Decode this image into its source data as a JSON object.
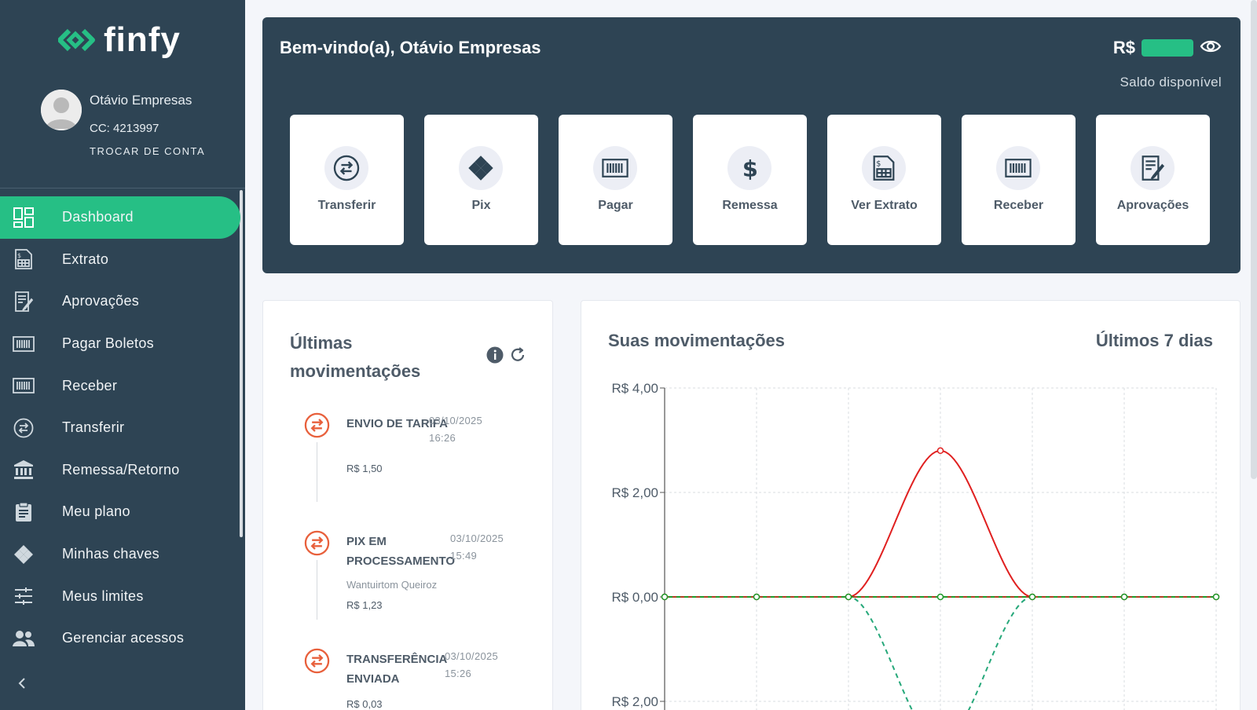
{
  "brand": {
    "name": "finfy",
    "accent": "#26bf85",
    "dark": "#2e4454"
  },
  "profile": {
    "name": "Otávio Empresas",
    "account": "CC: 4213997",
    "switch_label": "TROCAR DE CONTA"
  },
  "sidebar": {
    "items": [
      {
        "label": "Dashboard",
        "icon": "dashboard-icon",
        "active": true
      },
      {
        "label": "Extrato",
        "icon": "statement-icon"
      },
      {
        "label": "Aprovações",
        "icon": "approval-icon"
      },
      {
        "label": "Pagar Boletos",
        "icon": "barcode-icon"
      },
      {
        "label": "Receber",
        "icon": "barcode-icon"
      },
      {
        "label": "Transferir",
        "icon": "transfer-icon"
      },
      {
        "label": "Remessa/Retorno",
        "icon": "bank-icon"
      },
      {
        "label": "Meu plano",
        "icon": "clipboard-icon"
      },
      {
        "label": "Minhas chaves",
        "icon": "pix-icon"
      },
      {
        "label": "Meus limites",
        "icon": "sliders-icon"
      },
      {
        "label": "Gerenciar acessos",
        "icon": "users-icon"
      }
    ]
  },
  "header": {
    "welcome": "Bem-vindo(a), Otávio Empresas",
    "currency": "R$",
    "balance_label": "Saldo disponível",
    "actions": [
      {
        "label": "Transferir",
        "icon": "transfer-icon"
      },
      {
        "label": "Pix",
        "icon": "pix-icon"
      },
      {
        "label": "Pagar",
        "icon": "barcode-icon"
      },
      {
        "label": "Remessa",
        "icon": "dollar-icon"
      },
      {
        "label": "Ver Extrato",
        "icon": "statement-icon"
      },
      {
        "label": "Receber",
        "icon": "barcode-icon"
      },
      {
        "label": "Aprovações",
        "icon": "approval-icon"
      }
    ]
  },
  "last_transactions": {
    "title": "Últimas movimentações",
    "items": [
      {
        "title": "ENVIO DE TARIFA",
        "date": "03/10/2025",
        "time": "16:26",
        "subtitle": "",
        "amount": "R$ 1,50"
      },
      {
        "title": "PIX EM PROCESSAMENTO",
        "date": "03/10/2025",
        "time": "15:49",
        "subtitle": "Wantuirtom Queiroz",
        "amount": "R$ 1,23"
      },
      {
        "title": "TRANSFERÊNCIA ENVIADA",
        "date": "03/10/2025",
        "time": "15:26",
        "subtitle": "",
        "amount": "R$ 0,03"
      }
    ]
  },
  "chart_data": {
    "type": "line",
    "title": "Suas movimentações",
    "period": "Últimos 7 dias",
    "y_tick_labels": [
      "R$ 4,00",
      "R$ 2,00",
      "R$ 0,00",
      "R$ 2,00"
    ],
    "ylim": [
      -2,
      4
    ],
    "x": [
      0,
      1,
      2,
      3,
      4,
      5,
      6
    ],
    "grid": true,
    "series": [
      {
        "values": [
          0,
          0,
          0,
          2.8,
          0,
          0,
          0
        ],
        "color": "#e02020",
        "style": "solid"
      },
      {
        "values": [
          0,
          0,
          0,
          -2.8,
          0,
          0,
          0
        ],
        "color": "#26a87a",
        "style": "dashed"
      },
      {
        "values": [
          0,
          0,
          0,
          0,
          0,
          0,
          0
        ],
        "color": "#1e9a2a",
        "style": "solid"
      }
    ]
  }
}
